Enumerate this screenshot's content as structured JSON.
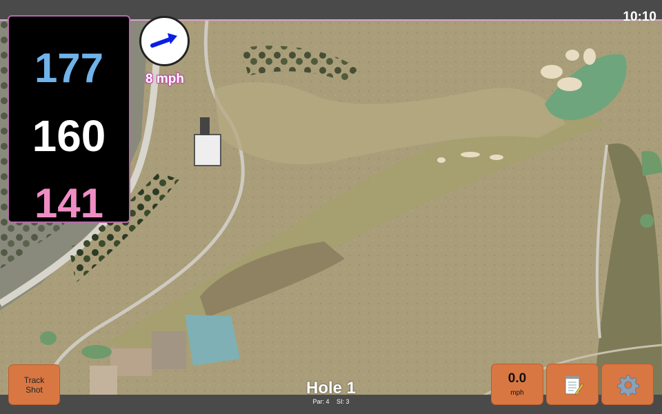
{
  "status": {
    "time": "10:10"
  },
  "distances": {
    "back": "177",
    "middle": "160",
    "front": "141"
  },
  "wind": {
    "speed_label": "8 mph",
    "icon": "wind-arrow-icon"
  },
  "hole": {
    "title": "Hole 1",
    "par": "Par: 4",
    "stroke_index": "SI: 3"
  },
  "buttons": {
    "track_shot_line1": "Track",
    "track_shot_line2": "Shot",
    "speed_value": "0.0",
    "speed_unit": "mph",
    "notes_icon": "notepad-icon",
    "settings_icon": "gear-icon"
  },
  "colors": {
    "back_distance": "#6fb3ea",
    "middle_distance": "#ffffff",
    "front_distance": "#f08cc4",
    "button_orange": "#d97743",
    "panel_border": "#b56aa8"
  }
}
